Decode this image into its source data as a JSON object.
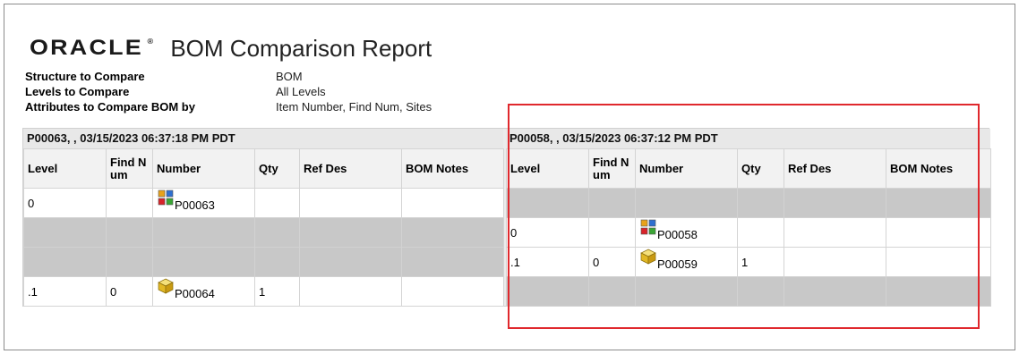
{
  "header": {
    "logo_text": "ORACLE",
    "logo_mark": "®",
    "title": "BOM Comparison Report"
  },
  "meta": [
    {
      "label": "Structure to Compare",
      "value": "BOM"
    },
    {
      "label": "Levels to Compare",
      "value": "All Levels"
    },
    {
      "label": "Attributes to Compare BOM by",
      "value": "Item Number, Find Num, Sites"
    }
  ],
  "columns": [
    "Level",
    "Find N um",
    "Number",
    "Qty",
    "Ref Des",
    "BOM Notes"
  ],
  "left": {
    "header": "P00063, , 03/15/2023 06:37:18 PM PDT",
    "rows": [
      {
        "gray": false,
        "level": "0",
        "find_num": "",
        "icon": "assembly-icon",
        "number": "P00063",
        "qty": "",
        "ref_des": "",
        "notes": ""
      },
      {
        "gray": true,
        "level": "",
        "find_num": "",
        "icon": "",
        "number": "",
        "qty": "",
        "ref_des": "",
        "notes": ""
      },
      {
        "gray": true,
        "level": "",
        "find_num": "",
        "icon": "",
        "number": "",
        "qty": "",
        "ref_des": "",
        "notes": ""
      },
      {
        "gray": false,
        "level": ".1",
        "find_num": "0",
        "icon": "part-icon",
        "number": "P00064",
        "qty": "1",
        "ref_des": "",
        "notes": ""
      }
    ]
  },
  "right": {
    "header": "P00058, , 03/15/2023 06:37:12 PM PDT",
    "rows": [
      {
        "gray": true,
        "level": "",
        "find_num": "",
        "icon": "",
        "number": "",
        "qty": "",
        "ref_des": "",
        "notes": ""
      },
      {
        "gray": false,
        "level": "0",
        "find_num": "",
        "icon": "assembly-icon",
        "number": "P00058",
        "qty": "",
        "ref_des": "",
        "notes": ""
      },
      {
        "gray": false,
        "level": ".1",
        "find_num": "0",
        "icon": "part-icon",
        "number": "P00059",
        "qty": "1",
        "ref_des": "",
        "notes": ""
      },
      {
        "gray": true,
        "level": "",
        "find_num": "",
        "icon": "",
        "number": "",
        "qty": "",
        "ref_des": "",
        "notes": ""
      }
    ]
  },
  "colors": {
    "highlight": "#e0282d",
    "gray_row": "#c8c8c8",
    "panel_header": "#e8e8e8"
  }
}
